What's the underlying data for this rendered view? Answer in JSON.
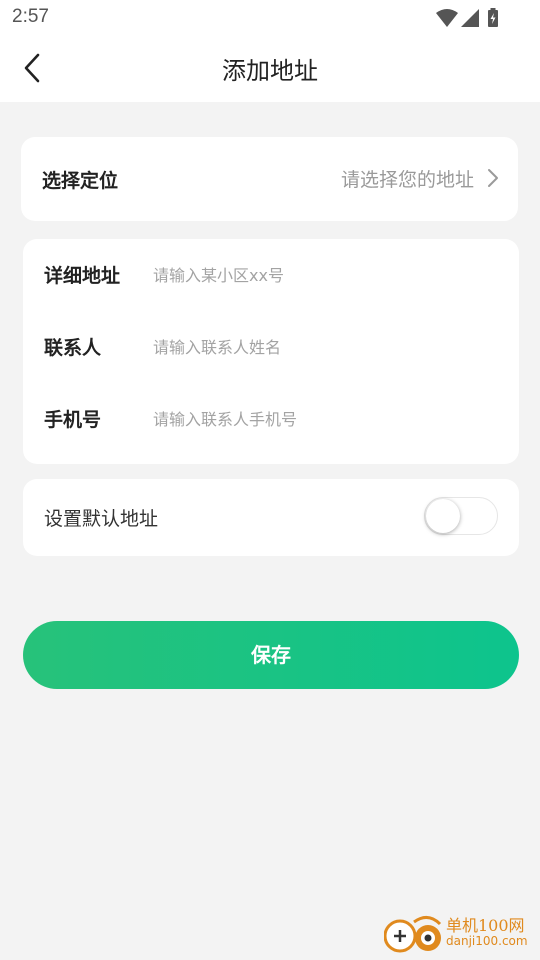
{
  "status_bar": {
    "time": "2:57",
    "icons": [
      "wifi-icon",
      "signal-icon",
      "battery-charging-icon"
    ]
  },
  "header": {
    "title": "添加地址",
    "back_icon": "chevron-left-icon"
  },
  "location": {
    "label": "选择定位",
    "value": "请选择您的地址",
    "arrow_icon": "chevron-right-icon"
  },
  "form": {
    "detail_label": "详细地址",
    "detail_placeholder": "请输入某小区xx号",
    "contact_label": "联系人",
    "contact_placeholder": "请输入联系人姓名",
    "phone_label": "手机号",
    "phone_placeholder": "请输入联系人手机号"
  },
  "default_address": {
    "label": "设置默认地址",
    "enabled": false
  },
  "save_label": "保存",
  "watermark": {
    "name": "单机100网",
    "url": "danji100.com"
  },
  "colors": {
    "accent_start": "#27c27a",
    "accent_end": "#0dc48d",
    "background": "#f3f3f3",
    "watermark": "#e08a1e"
  }
}
